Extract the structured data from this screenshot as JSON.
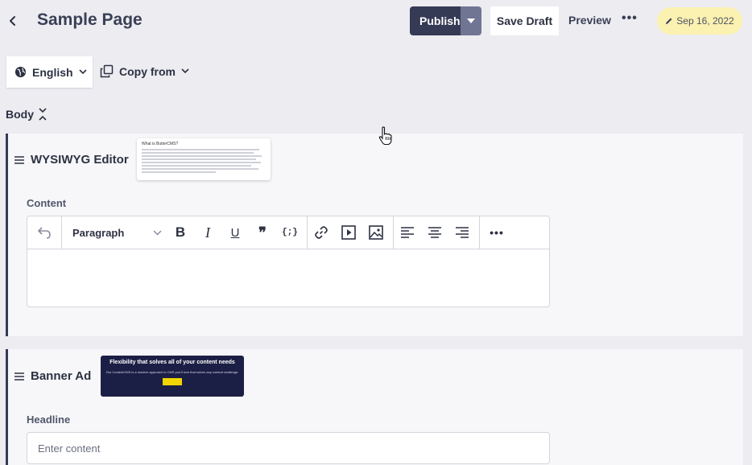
{
  "header": {
    "title": "Sample Page",
    "publish_label": "Publish",
    "save_draft_label": "Save Draft",
    "preview_label": "Preview",
    "more_label": "•••",
    "date_label": "Sep 16, 2022"
  },
  "locale": {
    "language_label": "English",
    "copy_from_label": "Copy from"
  },
  "body_section": {
    "label": "Body"
  },
  "components": [
    {
      "title": "WYSIWYG Editor",
      "field_label": "Content",
      "thumbnail_title": "What is ButterCMS?",
      "toolbar": {
        "block_format": "Paragraph",
        "bold": "B",
        "italic": "I",
        "underline": "U",
        "quote": "❞",
        "code": "{;}",
        "more": "•••"
      }
    },
    {
      "title": "Banner Ad",
      "field_label": "Headline",
      "placeholder": "Enter content",
      "thumbnail_title": "Flexibility that solves all of your content needs",
      "thumbnail_subtitle": "Our ContentCMS is a modern approach to CMS you'll love that solves any content challenge."
    }
  ],
  "colors": {
    "primary_dark": "#353a55",
    "publish_caret": "#707593",
    "date_pill": "#fbf1b0",
    "background": "#ececf1",
    "banner_bg": "#1c1f45",
    "banner_button": "#f1d400"
  }
}
